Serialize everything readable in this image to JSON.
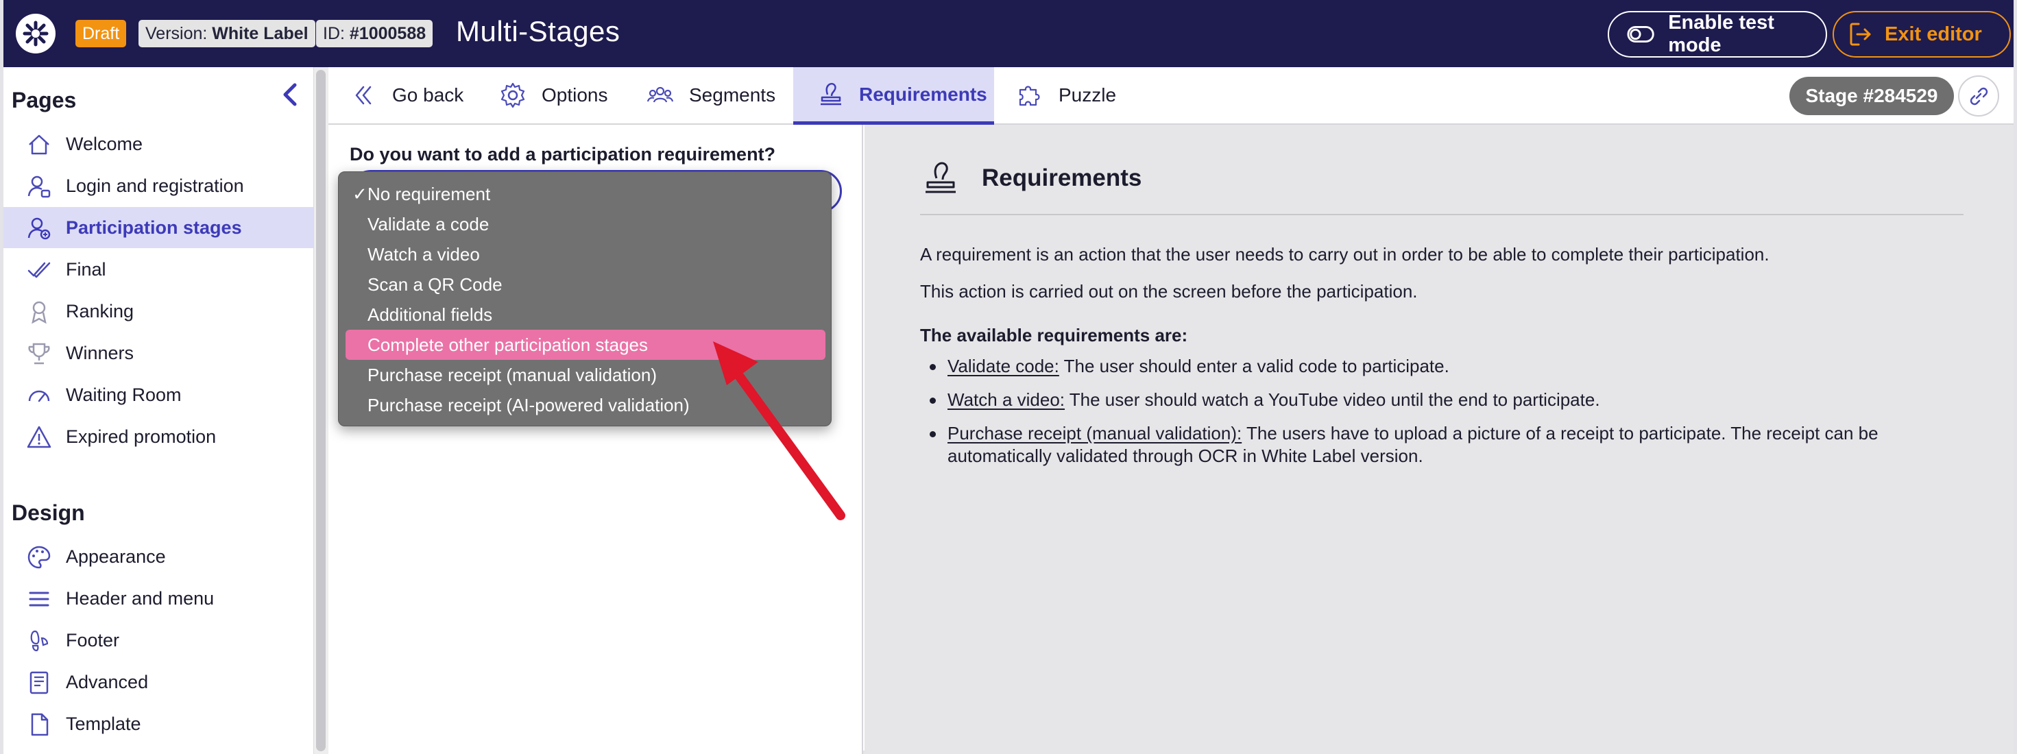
{
  "topbar": {
    "badges": {
      "draft": "Draft",
      "version_label": "Version:",
      "version_value": "White Label",
      "id_label": "ID:",
      "id_value": "#1000588"
    },
    "title": "Multi-Stages",
    "test_mode_label": "Enable test mode",
    "exit_label": "Exit editor",
    "colors": {
      "bar": "#1e1b4f",
      "accent": "#f29312"
    }
  },
  "sidebar": {
    "pages_title": "Pages",
    "pages": [
      {
        "label": "Welcome",
        "icon": "home-icon"
      },
      {
        "label": "Login and registration",
        "icon": "user-lock-icon"
      },
      {
        "label": "Participation stages",
        "icon": "user-add-icon",
        "active": true
      },
      {
        "label": "Final",
        "icon": "double-check-icon"
      },
      {
        "label": "Ranking",
        "icon": "ranking-icon"
      },
      {
        "label": "Winners",
        "icon": "trophy-icon"
      },
      {
        "label": "Waiting Room",
        "icon": "gauge-icon"
      },
      {
        "label": "Expired promotion",
        "icon": "warning-icon"
      }
    ],
    "design_title": "Design",
    "design": [
      {
        "label": "Appearance",
        "icon": "palette-icon"
      },
      {
        "label": "Header and menu",
        "icon": "menu-icon"
      },
      {
        "label": "Footer",
        "icon": "footprint-icon"
      },
      {
        "label": "Advanced",
        "icon": "document-code-icon"
      },
      {
        "label": "Template",
        "icon": "file-icon"
      }
    ]
  },
  "tabs": [
    {
      "label": "Go back",
      "icon": "double-chevron-left-icon"
    },
    {
      "label": "Options",
      "icon": "gear-icon"
    },
    {
      "label": "Segments",
      "icon": "users-group-icon"
    },
    {
      "label": "Requirements",
      "icon": "stamp-icon",
      "active": true
    },
    {
      "label": "Puzzle",
      "icon": "puzzle-icon"
    }
  ],
  "stage_label": "Stage #284529",
  "form": {
    "question": "Do you want to add a participation requirement?",
    "selected": "No requirement",
    "options": [
      "No requirement",
      "Validate a code",
      "Watch a video",
      "Scan a QR Code",
      "Additional fields",
      "Complete other participation stages",
      "Purchase receipt (manual validation)",
      "Purchase receipt (AI-powered validation)"
    ],
    "check_mark": "✓",
    "highlighted_color": "#ea72a6"
  },
  "info": {
    "title": "Requirements",
    "paragraphs": [
      "A requirement is an action that the user needs to carry out in order to be able to complete their participation.",
      "This action is carried out on the screen before the participation."
    ],
    "available_title": "The available requirements are:",
    "items": [
      {
        "term": "Validate code:",
        "text": " The user should enter a valid code to participate."
      },
      {
        "term": "Watch a video:",
        "text": " The user should watch a YouTube video until the end to participate."
      },
      {
        "term": "Purchase receipt (manual validation):",
        "text": " The users have to upload a picture of a receipt to participate. The receipt can be automatically validated through OCR in White Label version."
      }
    ]
  }
}
